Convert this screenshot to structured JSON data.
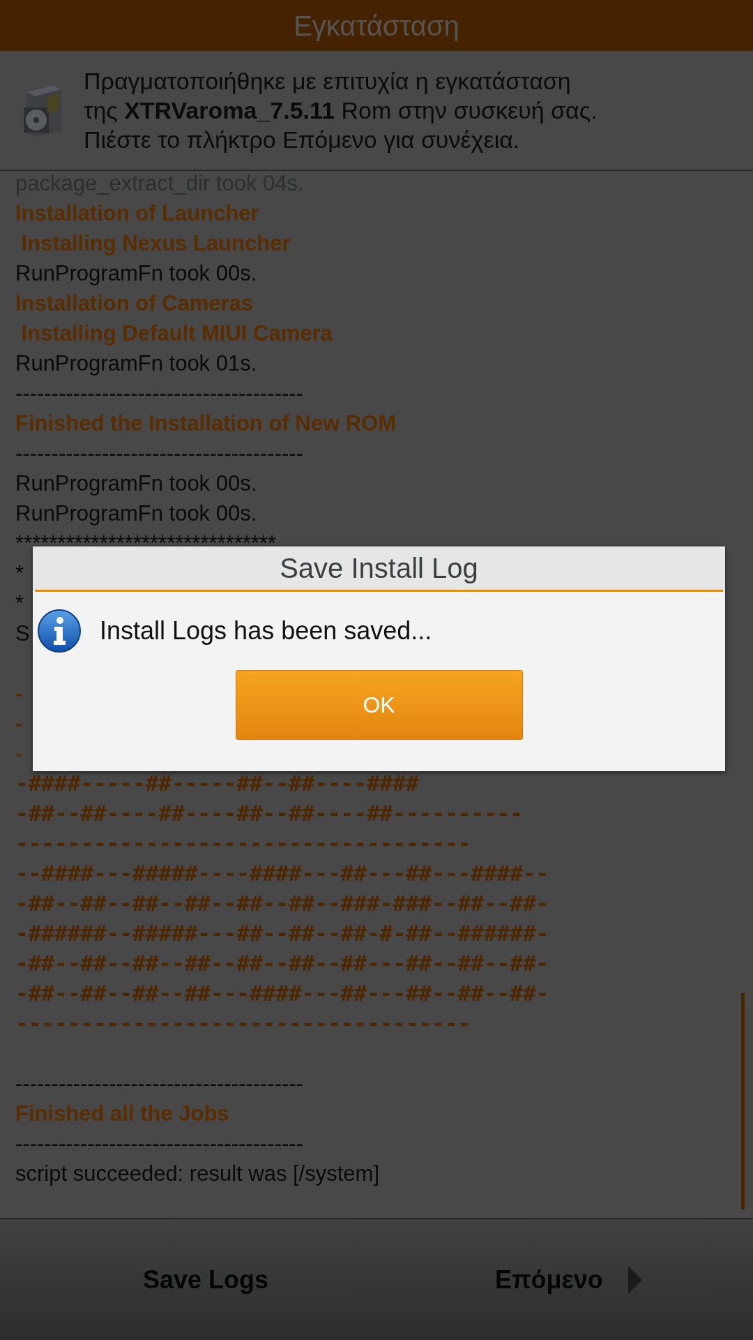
{
  "header": {
    "title": "Εγκατάσταση"
  },
  "message": {
    "text": "Πραγματοποιήθηκε με επιτυχία η εγκατάσταση\nτης **XTRVaroma_7.5.11** Rom στην συσκευή σας.\nΠιέστε το πλήκτρο Επόμενο για συνέχεια."
  },
  "log": {
    "lines": [
      {
        "kind": "faded",
        "text": "package_extract_dir took 04s."
      },
      {
        "kind": "heading",
        "text": "Installation of Launcher"
      },
      {
        "kind": "heading",
        "text": " Installing Nexus Launcher"
      },
      {
        "kind": "plain",
        "text": "RunProgramFn took 00s."
      },
      {
        "kind": "heading",
        "text": "Installation of Cameras"
      },
      {
        "kind": "heading",
        "text": " Installing Default MIUI Camera"
      },
      {
        "kind": "plain",
        "text": "RunProgramFn took 01s."
      },
      {
        "kind": "plain",
        "text": "----------------------------------------"
      },
      {
        "kind": "heading",
        "text": "Finished the Installation of New ROM"
      },
      {
        "kind": "plain",
        "text": "----------------------------------------"
      },
      {
        "kind": "plain",
        "text": "RunProgramFn took 00s."
      },
      {
        "kind": "plain",
        "text": "RunProgramFn took 00s."
      },
      {
        "kind": "plain",
        "text": "*******************************"
      },
      {
        "kind": "plain",
        "text": "*"
      },
      {
        "kind": "plain",
        "text": "*"
      },
      {
        "kind": "plain",
        "text": "S"
      },
      {
        "kind": "blank"
      },
      {
        "kind": "heading",
        "text": "-"
      },
      {
        "kind": "heading",
        "text": "-"
      },
      {
        "kind": "heading",
        "text": "-"
      },
      {
        "kind": "art",
        "text": "-####-----##-----##--##----####"
      },
      {
        "kind": "art",
        "text": "-##--##----##----##--##----##----------"
      },
      {
        "kind": "art",
        "text": "-----------------------------------"
      },
      {
        "kind": "art",
        "text": "--####---#####----####---##---##---####--"
      },
      {
        "kind": "art",
        "text": "-##--##--##--##--##--##--###-###--##--##-"
      },
      {
        "kind": "art",
        "text": "-######--#####---##--##--##-#-##--######-"
      },
      {
        "kind": "art",
        "text": "-##--##--##--##--##--##--##---##--##--##-"
      },
      {
        "kind": "art",
        "text": "-##--##--##--##---####---##---##--##--##-"
      },
      {
        "kind": "art",
        "text": "-----------------------------------"
      },
      {
        "kind": "blank"
      },
      {
        "kind": "plain",
        "text": "----------------------------------------"
      },
      {
        "kind": "heading",
        "text": "Finished all the Jobs"
      },
      {
        "kind": "plain",
        "text": "----------------------------------------"
      },
      {
        "kind": "plain",
        "text": "script succeeded: result was [/system]"
      }
    ]
  },
  "dialog": {
    "title": "Save Install Log",
    "message": "Install Logs has been saved...",
    "button": "OK"
  },
  "bottom_bar": {
    "buttons": [
      {
        "label": "Save Logs",
        "arrow": false
      },
      {
        "label": "Επόμενο",
        "arrow": true
      }
    ]
  }
}
